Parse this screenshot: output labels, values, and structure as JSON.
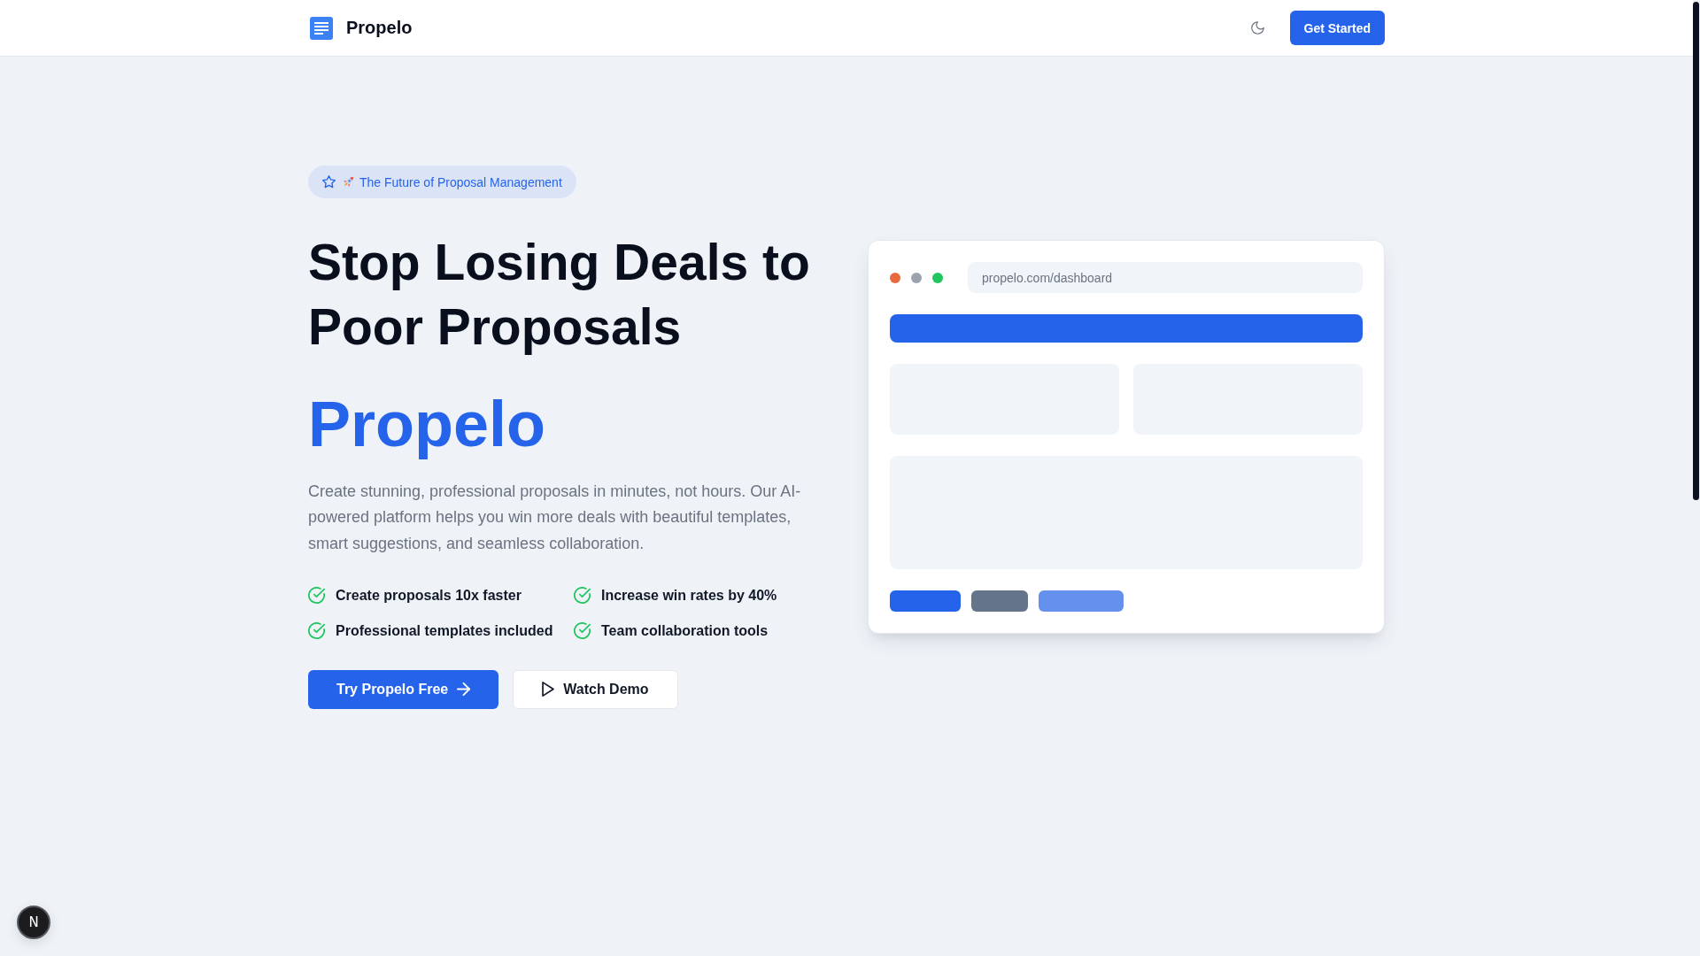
{
  "header": {
    "brand": "Propelo",
    "cta": "Get Started"
  },
  "hero": {
    "badge": "The Future of Proposal Management",
    "headline": "Stop Losing Deals to Poor Proposals",
    "brand_name": "Propelo",
    "description": "Create stunning, professional proposals in minutes, not hours. Our AI-powered platform helps you win more deals with beautiful templates, smart suggestions, and seamless collaboration.",
    "features": [
      "Create proposals 10x faster",
      "Increase win rates by 40%",
      "Professional templates included",
      "Team collaboration tools"
    ],
    "buttons": [
      {
        "label": "Try Propelo Free",
        "kind": "primary"
      },
      {
        "label": "Watch Demo",
        "kind": "secondary"
      }
    ]
  },
  "mockup": {
    "url": "propelo.com/dashboard",
    "dots": [
      {
        "color": "#e66a3d"
      },
      {
        "color": "#9ca3af"
      },
      {
        "color": "#22c55e"
      }
    ],
    "placeholder_buttons": [
      {
        "color": "#2563eb"
      },
      {
        "color": "#64748b"
      },
      {
        "color": "#6690ee"
      }
    ]
  },
  "dev_indicator": {
    "label": "N"
  }
}
